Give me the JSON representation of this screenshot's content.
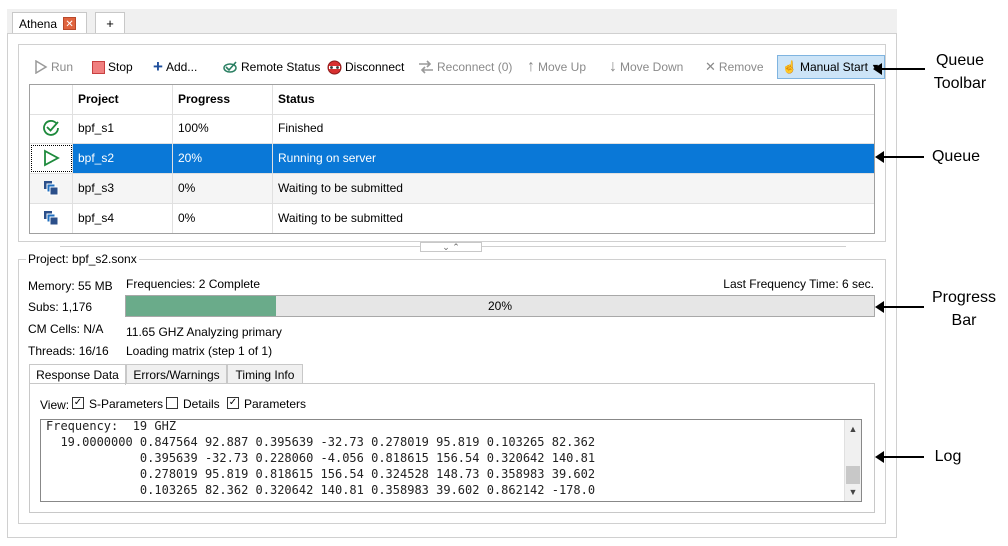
{
  "tabs": {
    "active_label": "Athena",
    "close_glyph": "✕",
    "add_glyph": "+"
  },
  "toolbar": {
    "run": "Run",
    "stop": "Stop",
    "add": "Add...",
    "remote_status": "Remote Status",
    "disconnect": "Disconnect",
    "reconnect": "Reconnect (0)",
    "move_up": "Move Up",
    "move_down": "Move Down",
    "remove": "Remove",
    "manual_start": "Manual Start"
  },
  "queue": {
    "columns": [
      "Project",
      "Progress",
      "Status"
    ],
    "rows": [
      {
        "project": "bpf_s1",
        "progress": "100%",
        "status": "Finished",
        "icon": "finished-check-icon"
      },
      {
        "project": "bpf_s2",
        "progress": "20%",
        "status": "Running on server",
        "icon": "running-play-icon"
      },
      {
        "project": "bpf_s3",
        "progress": "0%",
        "status": "Waiting to be submitted",
        "icon": "waiting-stack-icon"
      },
      {
        "project": "bpf_s4",
        "progress": "0%",
        "status": "Waiting to be submitted",
        "icon": "waiting-stack-icon"
      }
    ],
    "selected_row": 1
  },
  "project": {
    "legend": "Project: bpf_s2.sonx",
    "memory": "Memory: 55 MB",
    "subs": "Subs: 1,176",
    "cm_cells": "CM Cells: N/A",
    "threads": "Threads: 16/16",
    "frequencies": "Frequencies:  2 Complete",
    "last_frequency_time": "Last Frequency Time:  6 sec.",
    "progress_value": 0.2,
    "progress_text": "20%",
    "analyzing": "11.65 GHZ Analyzing primary",
    "loading": "Loading matrix (step 1 of 1)"
  },
  "details_tabs": [
    "Response Data",
    "Errors/Warnings",
    "Timing Info"
  ],
  "view": {
    "label": "View:",
    "options": [
      {
        "label": "S-Parameters",
        "checked": true
      },
      {
        "label": "Details",
        "checked": false
      },
      {
        "label": "Parameters",
        "checked": true
      }
    ]
  },
  "log": {
    "text": "Frequency:  19 GHZ\n  19.0000000 0.847564 92.887 0.395639 -32.73 0.278019 95.819 0.103265 82.362\n             0.395639 -32.73 0.228060 -4.056 0.818615 156.54 0.320642 140.81\n             0.278019 95.819 0.818615 156.54 0.324528 148.73 0.358983 39.602\n             0.103265 82.362 0.320642 140.81 0.358983 39.602 0.862142 -178.0"
  },
  "callouts": {
    "queue_toolbar": "Queue\nToolbar",
    "queue": "Queue",
    "progress_bar": "Progress\nBar",
    "log": "Log"
  },
  "colors": {
    "selection": "#0a78d7",
    "progress_fill": "#6aab8a",
    "accent_button": "#cce4f7"
  }
}
